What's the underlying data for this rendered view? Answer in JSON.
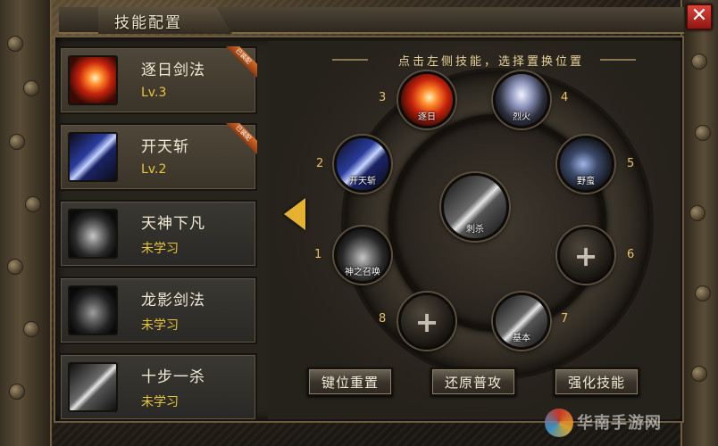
{
  "window": {
    "title": "技能配置",
    "close_glyph": "✕"
  },
  "hint": "点击左侧技能，选择置换位置",
  "skills": [
    {
      "name": "逐日剑法",
      "level": "Lv.3",
      "badge": "已装配",
      "icon": "fire-slash-icon",
      "status": "equipped"
    },
    {
      "name": "开天斩",
      "level": "Lv.2",
      "badge": "已装配",
      "icon": "blue-blade-icon",
      "status": "equipped"
    },
    {
      "name": "天神下凡",
      "level": "未学习",
      "icon": "god-figure-icon",
      "status": "unlearned"
    },
    {
      "name": "龙影剑法",
      "level": "未学习",
      "icon": "dragon-shadow-icon",
      "status": "unlearned"
    },
    {
      "name": "十步一杀",
      "level": "未学习",
      "icon": "ten-step-icon",
      "status": "unlearned"
    }
  ],
  "slots": [
    {
      "number": "1",
      "label": "神之召唤",
      "icon": "summon-icon"
    },
    {
      "number": "2",
      "label": "开天斩",
      "icon": "blue-blade-icon"
    },
    {
      "number": "3",
      "label": "逐日",
      "icon": "fire-slash-icon"
    },
    {
      "number": "4",
      "label": "烈火",
      "icon": "blaze-sword-icon"
    },
    {
      "number": "5",
      "label": "野蛮",
      "icon": "savage-charge-icon"
    },
    {
      "number": "6",
      "label": "+",
      "icon": "plus-icon"
    },
    {
      "number": "7",
      "label": "基本",
      "icon": "basic-sword-icon"
    },
    {
      "number": "8",
      "label": "+",
      "icon": "plus-icon"
    }
  ],
  "center_slot": {
    "label": "刺杀",
    "icon": "thrust-sword-icon"
  },
  "buttons": {
    "reset": "键位重置",
    "restore": "还原普攻",
    "enhance": "强化技能"
  },
  "watermark": "华南手游网",
  "colors": {
    "accent_gold": "#e8c63a",
    "close_red": "#d8352b",
    "arrow_gold": "#e6b030"
  }
}
